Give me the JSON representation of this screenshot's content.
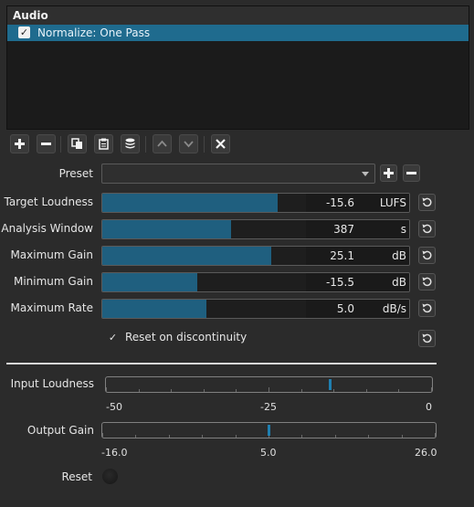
{
  "filters_panel": {
    "title": "Audio",
    "items": [
      {
        "label": "Normalize: One Pass",
        "checked": true,
        "check_glyph": "✓"
      }
    ]
  },
  "toolbar": {
    "buttons": [
      {
        "name": "add-filter-button",
        "icon": "plus-icon"
      },
      {
        "name": "remove-filter-button",
        "icon": "minus-icon"
      },
      {
        "name": "copy-filters-button",
        "icon": "copy-icon"
      },
      {
        "name": "paste-filters-button",
        "icon": "paste-icon"
      },
      {
        "name": "save-preset-button",
        "icon": "stack-icon"
      },
      {
        "name": "move-up-button",
        "icon": "chevron-up-icon"
      },
      {
        "name": "move-down-button",
        "icon": "chevron-down-icon"
      },
      {
        "name": "close-filter-button",
        "icon": "close-icon"
      }
    ]
  },
  "preset": {
    "label": "Preset",
    "value": ""
  },
  "params": [
    {
      "label": "Target Loudness",
      "value": "-15.6",
      "unit": "LUFS",
      "fill_fraction": 0.57
    },
    {
      "label": "Analysis Window",
      "value": "387",
      "unit": "s",
      "fill_fraction": 0.42
    },
    {
      "label": "Maximum Gain",
      "value": "25.1",
      "unit": "dB",
      "fill_fraction": 0.55
    },
    {
      "label": "Minimum Gain",
      "value": "-15.5",
      "unit": "dB",
      "fill_fraction": 0.31
    },
    {
      "label": "Maximum Rate",
      "value": "5.0",
      "unit": "dB/s",
      "fill_fraction": 0.34
    }
  ],
  "reset_on_discontinuity": {
    "label": "Reset on discontinuity",
    "checked": true,
    "check_glyph": "✓"
  },
  "input_loudness": {
    "label": "Input Loudness",
    "value": -15.6,
    "min": -50,
    "max": 0,
    "tick_labels": [
      "-50",
      "-25",
      "0"
    ]
  },
  "output_gain": {
    "label": "Output Gain",
    "value": 5.0,
    "min": -16.0,
    "max": 26.0,
    "tick_labels": [
      "-16.0",
      "5.0",
      "26.0"
    ]
  },
  "reset": {
    "label": "Reset"
  },
  "colors": {
    "accent": "#1f6b8e",
    "slider_fill": "#1f5f7f",
    "background": "#2b2b2b"
  }
}
